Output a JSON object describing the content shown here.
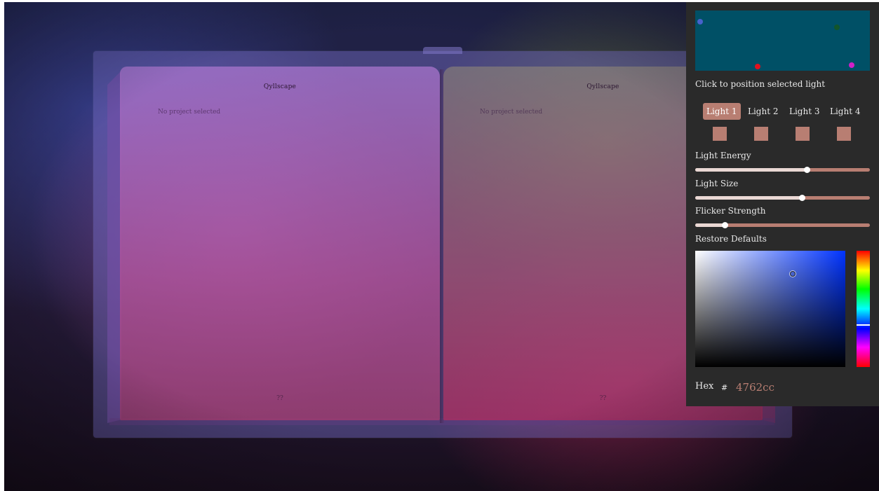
{
  "book": {
    "left_page": {
      "title": "Qyllscape",
      "status": "No project selected",
      "page_number": "??"
    },
    "right_page": {
      "title": "Qyllscape",
      "status": "No project selected",
      "page_number": "??"
    }
  },
  "light_panel": {
    "map_hint": "Click to position selected light",
    "map_background": "#005066",
    "lights": [
      {
        "label": "Light 1",
        "color": "#4762cc",
        "selected": true
      },
      {
        "label": "Light 2",
        "color": "#12552b",
        "selected": false
      },
      {
        "label": "Light 3",
        "color": "#e0101e",
        "selected": false
      },
      {
        "label": "Light 4",
        "color": "#d020c8",
        "selected": false
      }
    ],
    "swatch_color": "#b87e72",
    "sliders": [
      {
        "label": "Light Energy",
        "value": 0.64
      },
      {
        "label": "Light Size",
        "value": 0.61
      },
      {
        "label": "Flicker Strength",
        "value": 0.17
      }
    ],
    "restore_label": "Restore Defaults",
    "color_picker": {
      "hue_value": 0.63,
      "saturation": 0.65,
      "brightness": 0.8,
      "hex_label": "Hex",
      "hex_prefix": "#",
      "hex_value": "4762cc"
    }
  }
}
